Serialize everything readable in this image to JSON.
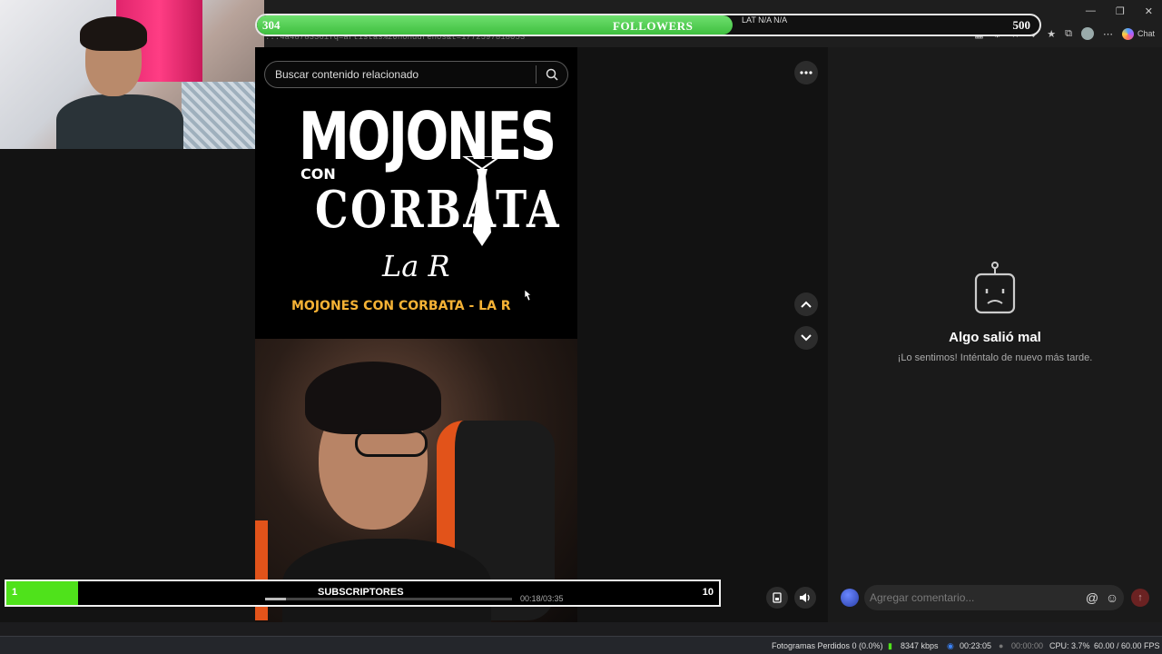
{
  "browser": {
    "url_fragment": "...4a48783361fq=artistas%20hondurenos&t=1772597818053",
    "chat_label": "Chat"
  },
  "followers": {
    "current": "304",
    "label": "FOLLOWERS",
    "goal": "500",
    "progress": 0.608,
    "extra": "LAT  N/A  N/A"
  },
  "search": {
    "placeholder": "Buscar contenido relacionado"
  },
  "video": {
    "title_line1": "MOJONES",
    "title_con": "CON",
    "title_line2": "CORBATA",
    "artist": "La R",
    "subtitle": "MOJONES CON CORBATA - LA R",
    "elapsed": "00:18/03:35",
    "progress": 0.084
  },
  "error": {
    "title": "Algo salió mal",
    "subtitle": "¡Lo sentimos! Inténtalo de nuevo más tarde."
  },
  "comment": {
    "placeholder": "Agregar comentario..."
  },
  "subscribers": {
    "current": "1",
    "label": "SUBSCRIPTORES",
    "goal": "10",
    "progress": 0.1
  },
  "status": {
    "dropped": "Fotogramas Perdidos 0 (0.0%)",
    "bitrate": "8347 kbps",
    "stream_time": "00:23:05",
    "rec_time": "00:00:00",
    "cpu": "CPU: 3.7%",
    "fps": "60.00 / 60.00 FPS"
  },
  "colors": {
    "followers_fill": "#4cc94c",
    "subs_fill": "#4fe21b",
    "accent_text": "#f5b235"
  }
}
